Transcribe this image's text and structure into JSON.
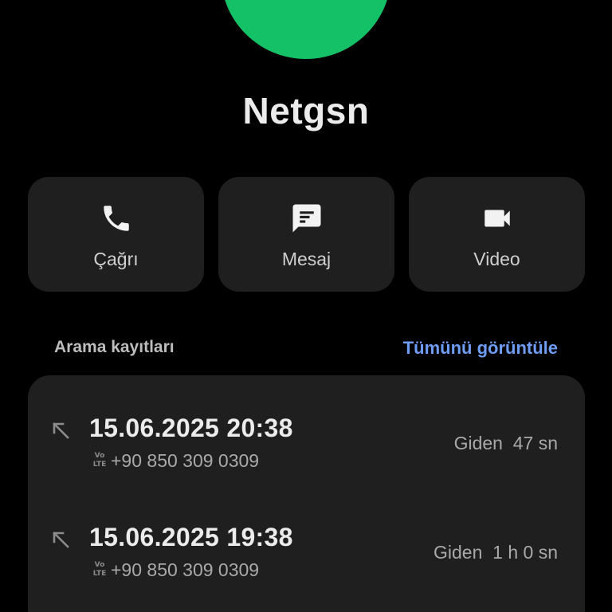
{
  "contact": {
    "name": "Netgsn",
    "avatar_color": "#14c167"
  },
  "actions": [
    {
      "label": "Çağrı",
      "icon": "phone-icon"
    },
    {
      "label": "Mesaj",
      "icon": "message-icon"
    },
    {
      "label": "Video",
      "icon": "video-camera-icon"
    }
  ],
  "call_log": {
    "title": "Arama kayıtları",
    "view_all": "Tümünü görüntüle",
    "link_color": "#6f9cf5",
    "entries": [
      {
        "datetime": "15.06.2025 20:38",
        "number": "+90 850 309 0309",
        "badge": "Vo LTE",
        "type": "Giden",
        "duration": "47 sn",
        "direction_icon": "outgoing-call-arrow-icon"
      },
      {
        "datetime": "15.06.2025 19:38",
        "number": "+90 850 309 0309",
        "badge": "Vo LTE",
        "type": "Giden",
        "duration": "1 h 0 sn",
        "direction_icon": "outgoing-call-arrow-icon"
      }
    ]
  }
}
